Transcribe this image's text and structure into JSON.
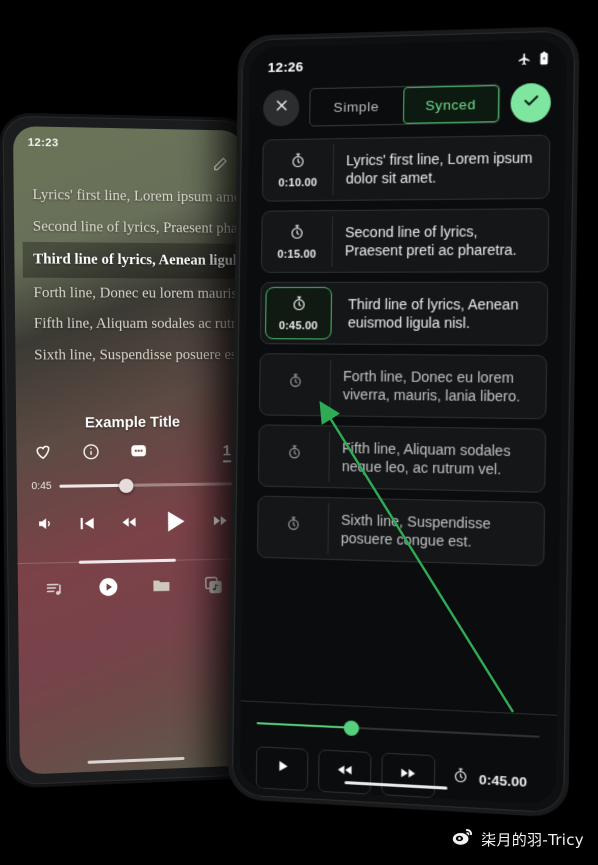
{
  "left_phone": {
    "status_time": "12:23",
    "edit_icon": "pencil-icon",
    "lyrics": [
      {
        "text": "Lyrics' first line, Lorem ipsum amet.",
        "active": false
      },
      {
        "text": "Second line of lyrics, Praesent pharetra.",
        "active": false
      },
      {
        "text": "Third line of lyrics, Aenean ligula nisl.",
        "active": true
      },
      {
        "text": "Forth line, Donec eu lorem mauris, lania libero.",
        "active": false
      },
      {
        "text": "Fifth line, Aliquam sodales ac rutrum vel.",
        "active": false
      },
      {
        "text": "Sixth line, Suspendisse posuere est.",
        "active": false
      }
    ],
    "track_title": "Example Title",
    "action_icons": [
      "heart-icon",
      "info-icon",
      "more-dots-icon"
    ],
    "queue_count": "1",
    "seek": {
      "current_time": "0:45",
      "progress_percent": 38
    },
    "transport": [
      "volume-icon",
      "previous-track-icon",
      "rewind-icon",
      "play-icon",
      "fast-forward-icon"
    ],
    "nav": [
      {
        "icon": "playlist-icon",
        "active": false
      },
      {
        "icon": "play-circle-icon",
        "active": true
      },
      {
        "icon": "folder-icon",
        "active": false
      },
      {
        "icon": "albums-icon",
        "active": false
      }
    ]
  },
  "right_phone": {
    "status_time": "12:26",
    "status_icons": [
      "airplane-mode-icon",
      "battery-icon"
    ],
    "toolbar": {
      "close_icon": "close-icon",
      "confirm_icon": "check-icon",
      "segments": [
        {
          "label": "Simple",
          "selected": false
        },
        {
          "label": "Synced",
          "selected": true
        }
      ]
    },
    "lyric_rows": [
      {
        "time": "0:10.00",
        "text": "Lyrics' first line, Lorem ipsum dolor sit amet.",
        "highlighted": false,
        "dim": false
      },
      {
        "time": "0:15.00",
        "text": "Second line of lyrics, Praesent preti ac pharetra.",
        "highlighted": false,
        "dim": false
      },
      {
        "time": "0:45.00",
        "text": "Third line of lyrics, Aenean euismod ligula nisl.",
        "highlighted": true,
        "dim": false
      },
      {
        "time": "",
        "text": "Forth line, Donec eu lorem viverra, mauris, lania libero.",
        "highlighted": false,
        "dim": true
      },
      {
        "time": "",
        "text": "Fifth line, Aliquam sodales neque leo, ac rutrum vel.",
        "highlighted": false,
        "dim": true
      },
      {
        "time": "",
        "text": "Sixth line, Suspendisse posuere congue est.",
        "highlighted": false,
        "dim": true
      }
    ],
    "player": {
      "progress_percent": 34,
      "buttons": [
        "play-icon",
        "rewind-icon",
        "fast-forward-icon"
      ],
      "timer_icon": "stopwatch-icon",
      "timer_value": "0:45.00"
    }
  },
  "annotation": {
    "arrow_color": "#2faa55",
    "points_to": "highlighted-timestamp"
  },
  "watermark": {
    "icon": "weibo-icon",
    "text": "柒月的羽-Tricy"
  },
  "colors": {
    "accent_green": "#7fe6a0",
    "sync_green": "#6fe08c",
    "arrow_green": "#2faa55",
    "card_bg": "#141617",
    "screen_bg": "#0b0c0d"
  }
}
